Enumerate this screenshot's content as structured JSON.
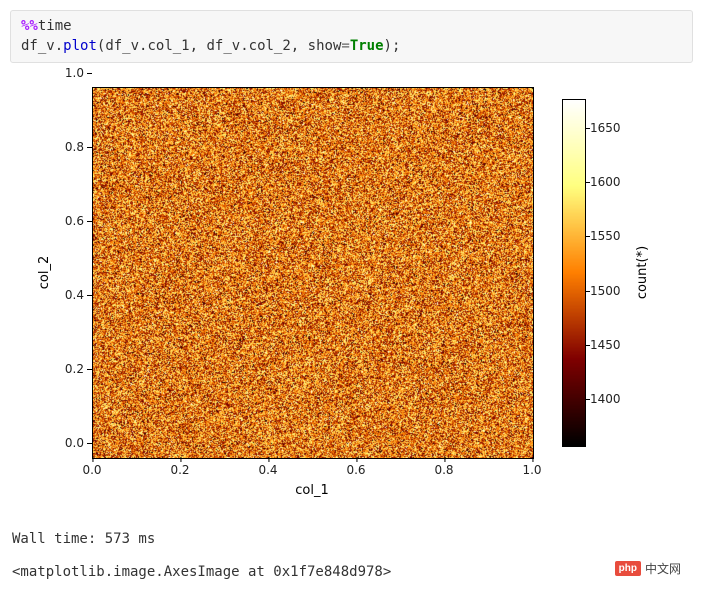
{
  "code": {
    "line1_magic": "%%",
    "line1_rest": "time",
    "line2_var": "df_v",
    "line2_method": "plot",
    "line2_arg1a": "df_v",
    "line2_arg1b": "col_1",
    "line2_arg2a": "df_v",
    "line2_arg2b": "col_2",
    "line2_kwarg": "show",
    "line2_kwval": "True"
  },
  "chart_data": {
    "type": "heatmap",
    "title": "",
    "xlabel": "col_1",
    "ylabel": "col_2",
    "xlim": [
      0.0,
      1.0
    ],
    "ylim": [
      0.0,
      1.0
    ],
    "x_ticks": [
      "0.0",
      "0.2",
      "0.4",
      "0.6",
      "0.8",
      "1.0"
    ],
    "y_ticks": [
      "0.0",
      "0.2",
      "0.4",
      "0.6",
      "0.8",
      "1.0"
    ],
    "colorbar": {
      "label": "count(*)",
      "ticks": [
        1400,
        1450,
        1500,
        1550,
        1600,
        1650
      ],
      "range_est": [
        1370,
        1690
      ],
      "cmap": "afmhot"
    },
    "description": "2D histogram of uniformly distributed points across [0,1]×[0,1]; bin counts roughly uniform around ~1530 ± ~150 (noisy speckle, no visible structure)."
  },
  "output": {
    "wall_time": "Wall time: 573 ms",
    "repr": "<matplotlib.image.AxesImage at 0x1f7e848d978>"
  },
  "badge": {
    "logo": "php",
    "text": "中文网"
  }
}
